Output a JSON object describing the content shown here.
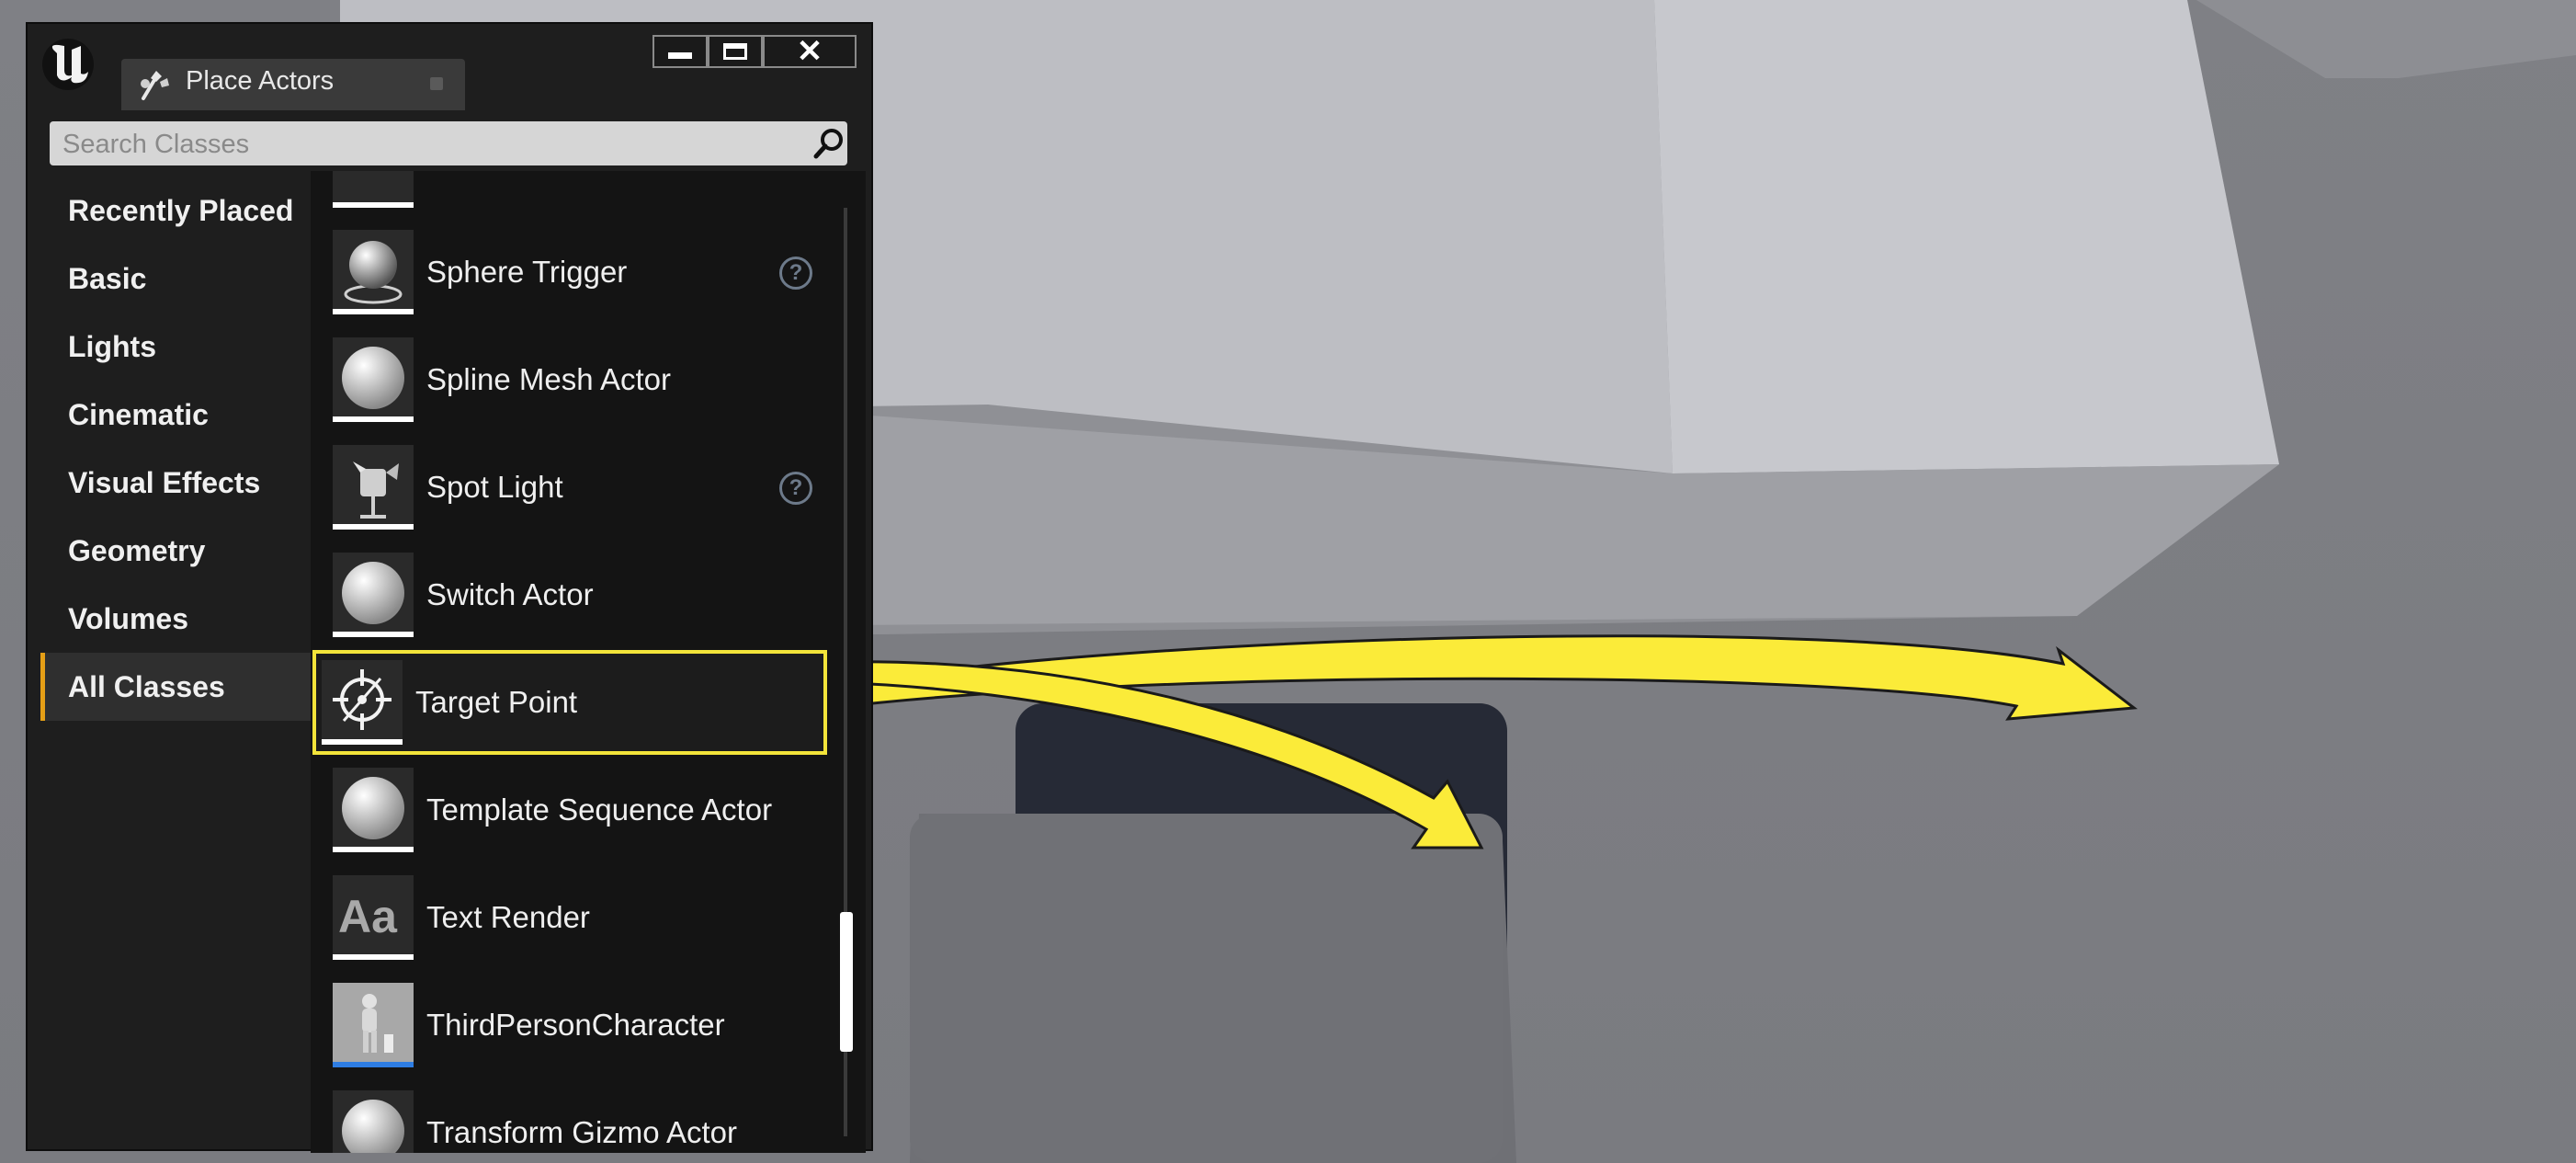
{
  "tab": {
    "title": "Place Actors",
    "icon": "place-actors-icon"
  },
  "window_controls": {
    "minimize_icon": "minimize-icon",
    "maximize_icon": "maximize-icon",
    "close_icon": "close-icon",
    "close_glyph": "✕"
  },
  "search": {
    "placeholder": "Search Classes",
    "value": ""
  },
  "categories": [
    {
      "label": "Recently Placed"
    },
    {
      "label": "Basic"
    },
    {
      "label": "Lights"
    },
    {
      "label": "Cinematic"
    },
    {
      "label": "Visual Effects"
    },
    {
      "label": "Geometry"
    },
    {
      "label": "Volumes"
    },
    {
      "label": "All Classes",
      "selected": true
    }
  ],
  "classes": [
    {
      "label": "Sphere Trigger",
      "icon": "sphere-trigger-icon",
      "help": true
    },
    {
      "label": "Spline Mesh Actor",
      "icon": "sphere-icon"
    },
    {
      "label": "Spot Light",
      "icon": "spot-light-icon",
      "help": true
    },
    {
      "label": "Switch Actor",
      "icon": "sphere-icon"
    },
    {
      "label": "Target Point",
      "icon": "target-point-icon",
      "selected": true
    },
    {
      "label": "Template Sequence Actor",
      "icon": "sphere-icon"
    },
    {
      "label": "Text Render",
      "icon": "text-render-icon",
      "thumb_text": "Aa"
    },
    {
      "label": "ThirdPersonCharacter",
      "icon": "character-icon"
    },
    {
      "label": "Transform Gizmo Actor",
      "icon": "sphere-icon"
    }
  ],
  "help_glyph": "?",
  "colors": {
    "highlight": "#f3e43a",
    "active_category": "#e59f16",
    "arrow": "#fbeb39"
  }
}
